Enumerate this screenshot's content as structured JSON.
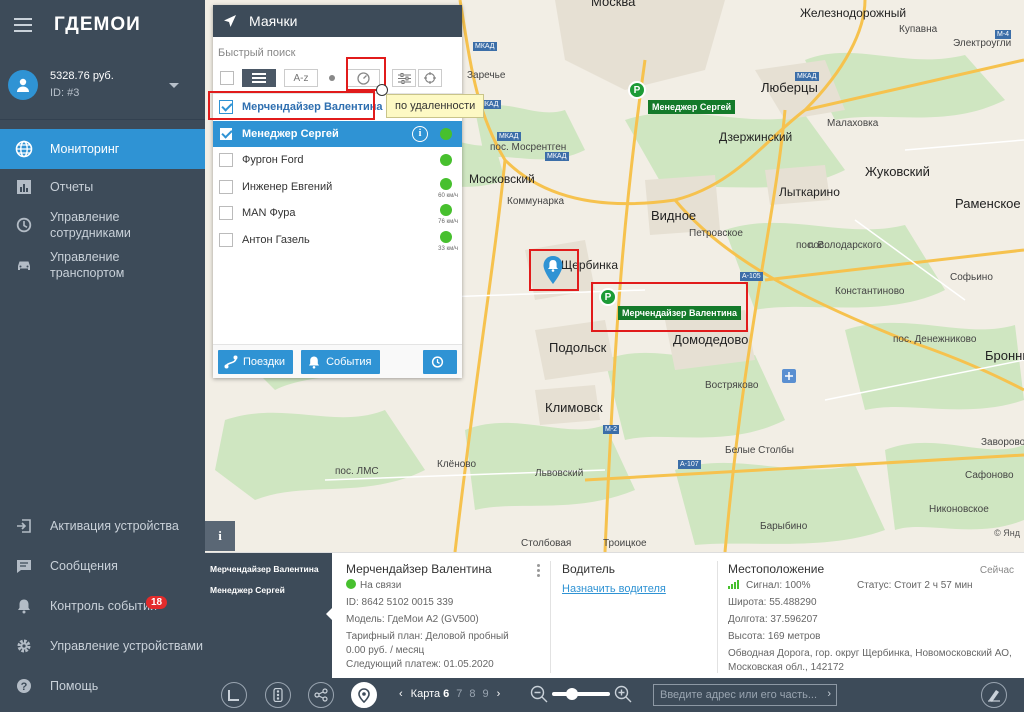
{
  "app": {
    "logo": "ГДЕМОИ"
  },
  "account": {
    "balance": "5328.76 руб.",
    "id": "ID: #3"
  },
  "nav": [
    {
      "label": "Мониторинг",
      "icon": "globe-icon",
      "active": true
    },
    {
      "label": "Отчеты",
      "icon": "bar-chart-icon"
    },
    {
      "label": "Управление сотрудниками",
      "icon": "clock-icon"
    },
    {
      "label": "Управление транспортом",
      "icon": "car-icon"
    }
  ],
  "nav_bottom": [
    {
      "label": "Активация устройства",
      "icon": "login-icon"
    },
    {
      "label": "Сообщения",
      "icon": "message-icon"
    },
    {
      "label": "Контроль событий",
      "icon": "bell-icon",
      "badge": "18"
    },
    {
      "label": "Управление устройствами",
      "icon": "gear-icon"
    },
    {
      "label": "Помощь",
      "icon": "help-icon"
    }
  ],
  "panel": {
    "title": "Маячки",
    "quick_search": "Быстрый поиск",
    "sort_az": "A-z",
    "tooltip": "по удаленности",
    "trips_label": "Поездки",
    "events_label": "События",
    "items": [
      {
        "name": "Мерчендайзер Валентина",
        "checked": true,
        "state": "white-selected"
      },
      {
        "name": "Менеджер Сергей",
        "checked": true,
        "state": "selected"
      },
      {
        "name": "Фургон Ford",
        "checked": false
      },
      {
        "name": "Инженер Евгений",
        "checked": false,
        "speed": "60 км/ч"
      },
      {
        "name": "MAN Фура",
        "checked": false,
        "speed": "76 км/ч"
      },
      {
        "name": "Антон Газель",
        "checked": false,
        "speed": "33 км/ч"
      }
    ]
  },
  "map": {
    "towns": [
      {
        "name": "Москва"
      },
      {
        "name": "Железнодорожный"
      },
      {
        "name": "Купавна"
      },
      {
        "name": "Электроугли"
      },
      {
        "name": "Люберцы"
      },
      {
        "name": "Дзержинский"
      },
      {
        "name": "Малаховка"
      },
      {
        "name": "Жуковский"
      },
      {
        "name": "Лыткарино"
      },
      {
        "name": "Раменское"
      },
      {
        "name": "Московский"
      },
      {
        "name": "Видное"
      },
      {
        "name": "Петровское"
      },
      {
        "name": "Щербинка"
      },
      {
        "name": "Подольск"
      },
      {
        "name": "Домодедово"
      },
      {
        "name": "Климовск"
      },
      {
        "name": "Востряково"
      },
      {
        "name": "Белые Столбы"
      },
      {
        "name": "Львовский"
      },
      {
        "name": "Барыбино"
      },
      {
        "name": "Столбовая"
      },
      {
        "name": "Троицкое"
      },
      {
        "name": "Заречье"
      },
      {
        "name": "пос. Мосрентген"
      },
      {
        "name": "Коммунарка"
      },
      {
        "name": "пос. Володарского"
      },
      {
        "name": "Константиново"
      },
      {
        "name": "Софьино"
      },
      {
        "name": "Бронни"
      },
      {
        "name": "пос. Денежниково"
      },
      {
        "name": "пос. ЛМС"
      },
      {
        "name": "Клёново"
      },
      {
        "name": "Никоновское"
      },
      {
        "name": "Заворово"
      },
      {
        "name": "пос."
      },
      {
        "name": "Сафоново"
      }
    ],
    "road_tags": [
      "МКАД",
      "МКАД",
      "МКАД",
      "МКАД",
      "МКАД",
      "А-105",
      "А-107",
      "М-2",
      "М-4"
    ],
    "markers": [
      {
        "label": "Менеджер Сергей",
        "letter": "P"
      },
      {
        "label": "Мерчендайзер Валентина",
        "letter": "P"
      }
    ],
    "copyright": "© Янд"
  },
  "bottom": {
    "list": [
      "Мерчендайзер Валентина",
      "Менеджер Сергей"
    ],
    "device": {
      "title": "Мерчендайзер Валентина",
      "status": "На связи",
      "id": "ID: 8642 5102 0015 339",
      "model": "Модель: ГдеМои А2 (GV500)",
      "plan": "Тарифный план: Деловой пробный",
      "price": "0.00 руб. / месяц",
      "next_payment": "Следующий платеж: 01.05.2020"
    },
    "driver": {
      "title": "Водитель",
      "assign_link": "Назначить водителя"
    },
    "location": {
      "title": "Местоположение",
      "now": "Сейчас",
      "signal": "Сигнал: 100%",
      "status": "Статус: Стоит 2 ч 57 мин",
      "lat": "Широта: 55.488290",
      "lon": "Долгота: 37.596207",
      "alt": "Высота: 169 метров",
      "address": "Обводная Дорога, гор. округ Щербинка, Новомосковский АО, Московская обл., 142172"
    }
  },
  "toolbar": {
    "map_label": "Карта",
    "map_pages": [
      "6",
      "7",
      "8",
      "9"
    ],
    "address_placeholder": "Введите адрес или его часть...",
    "zoom_level": 0.3
  }
}
